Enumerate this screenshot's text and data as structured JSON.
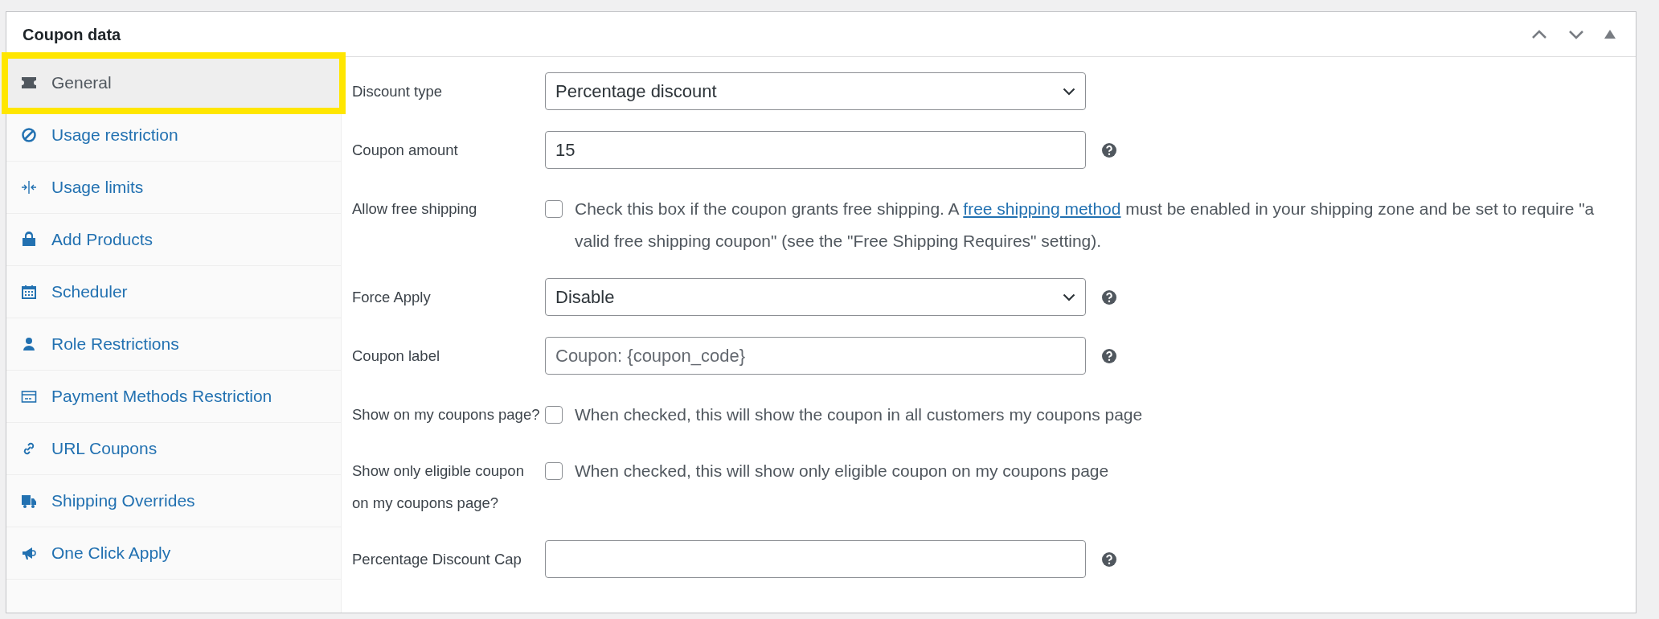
{
  "panel": {
    "title": "Coupon data"
  },
  "tabs": [
    {
      "label": "General",
      "selected": true
    },
    {
      "label": "Usage restriction",
      "selected": false
    },
    {
      "label": "Usage limits",
      "selected": false
    },
    {
      "label": "Add Products",
      "selected": false
    },
    {
      "label": "Scheduler",
      "selected": false
    },
    {
      "label": "Role Restrictions",
      "selected": false
    },
    {
      "label": "Payment Methods Restriction",
      "selected": false
    },
    {
      "label": "URL Coupons",
      "selected": false
    },
    {
      "label": "Shipping Overrides",
      "selected": false
    },
    {
      "label": "One Click Apply",
      "selected": false
    }
  ],
  "fields": [
    {
      "kind": "select",
      "label": "Discount type",
      "value": "Percentage discount",
      "help": false
    },
    {
      "kind": "text",
      "label": "Coupon amount",
      "value": "15",
      "help": true
    },
    {
      "kind": "checkbox",
      "label": "Allow free shipping",
      "checked": false,
      "description": "Check this box if the coupon grants free shipping. A",
      "link": "free shipping method",
      "description_after": "must be enabled in your shipping zone and be set to require \"a valid free shipping coupon\" (see the \"Free Shipping Requires\" setting)."
    },
    {
      "kind": "select",
      "label": "Force Apply",
      "value": "Disable",
      "help": true
    },
    {
      "kind": "text",
      "label": "Coupon label",
      "placeholder": "Coupon: {coupon_code}",
      "help": true
    },
    {
      "kind": "checkbox",
      "label": "Show on my coupons page?",
      "checked": false,
      "description": "When checked, this will show the coupon in all customers my coupons page"
    },
    {
      "kind": "checkbox",
      "label": "Show only eligible coupon on my coupons page?",
      "checked": false,
      "description": "When checked, this will show only eligible coupon on my coupons page"
    },
    {
      "kind": "text",
      "label": "Percentage Discount Cap",
      "help": true
    }
  ]
}
